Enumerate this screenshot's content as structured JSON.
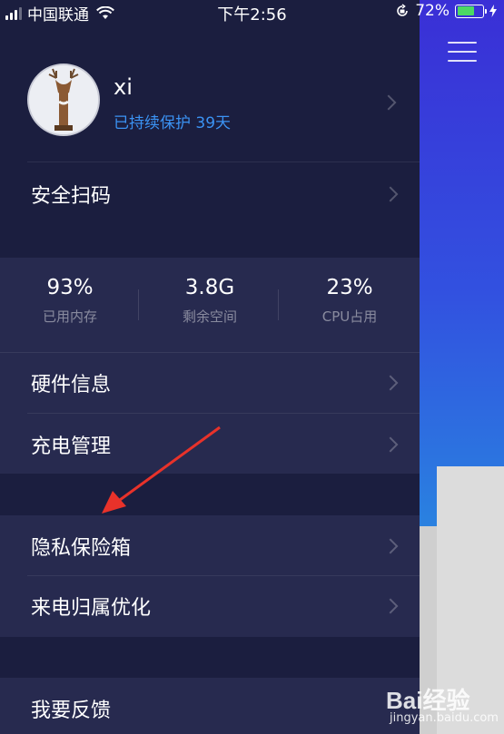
{
  "status_bar": {
    "carrier": "中国联通",
    "time": "下午2:56",
    "battery": "72%",
    "battery_level": 0.72
  },
  "main": {
    "menu_icon": "hamburger-icon"
  },
  "profile": {
    "name": "xi",
    "protection": "已持续保护 39天"
  },
  "menu": {
    "scan": "安全扫码",
    "hardware": "硬件信息",
    "charging": "充电管理",
    "vault": "隐私保险箱",
    "caller_location": "来电归属优化",
    "feedback": "我要反馈"
  },
  "stats": [
    {
      "value": "93%",
      "label": "已用内存"
    },
    {
      "value": "3.8G",
      "label": "剩余空间"
    },
    {
      "value": "23%",
      "label": "CPU占用"
    }
  ],
  "watermark": {
    "main": "Bai经验",
    "sub": "jingyan.baidu.com"
  },
  "colors": {
    "drawer_bg": "#1b1e3f",
    "section_bg": "#272a4f",
    "accent_blue": "#3b93f4",
    "arrow_red": "#e8322a",
    "battery_green": "#4cd964"
  }
}
